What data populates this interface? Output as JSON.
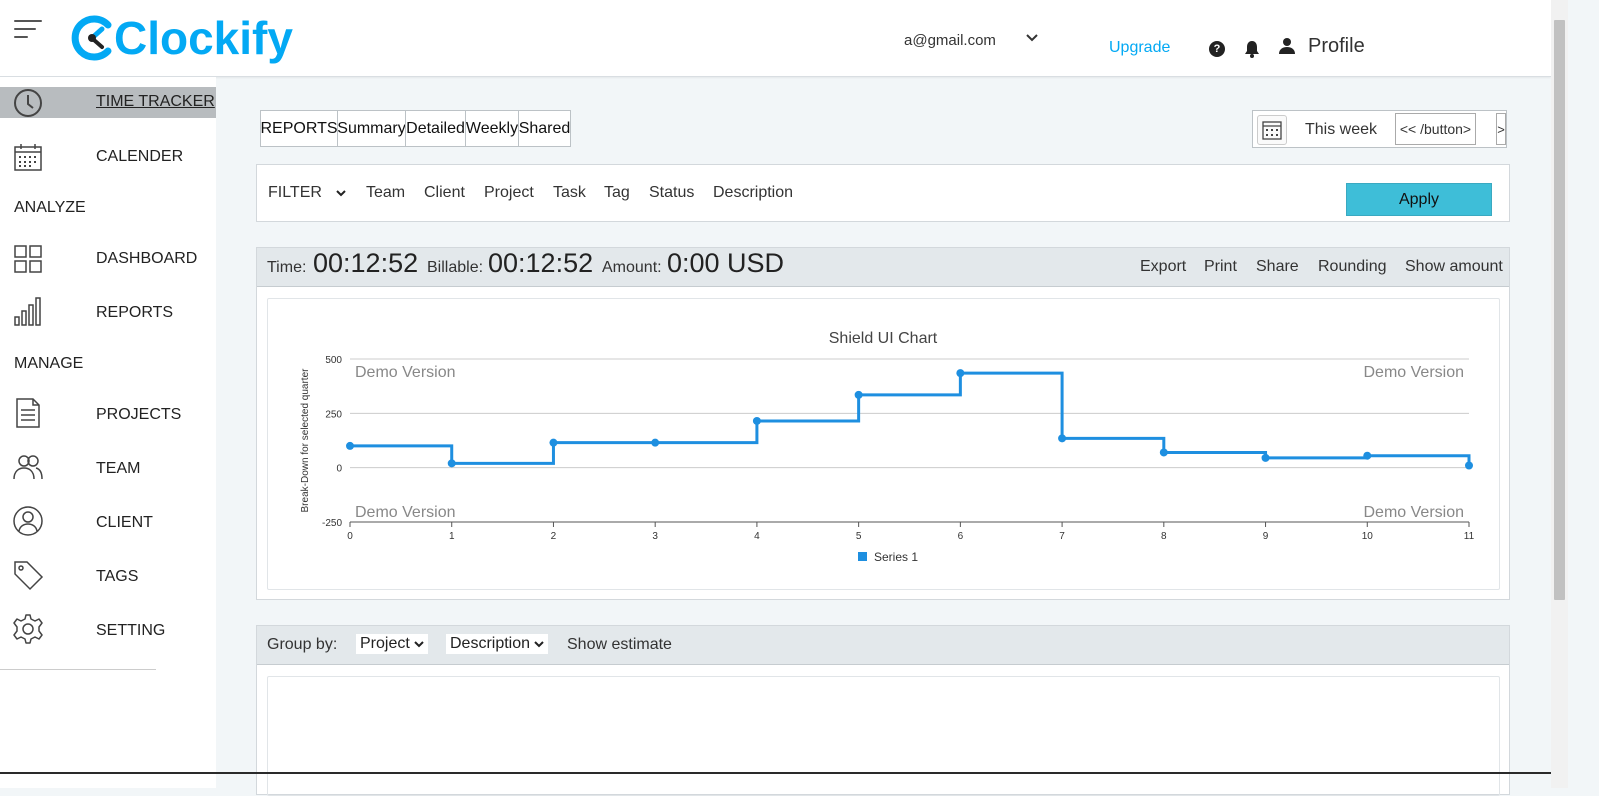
{
  "header": {
    "brand": "Clockify",
    "account_email": "a@gmail.com",
    "upgrade_label": "Upgrade",
    "help_glyph": "?",
    "profile_label": "Profile",
    "colors": {
      "brand": "#03a9f4",
      "upgrade": "#03a9f4"
    }
  },
  "sidebar": {
    "items": [
      {
        "label": "TIME TRACKER",
        "icon": "clock-icon",
        "active": true
      },
      {
        "label": "CALENDER",
        "icon": "calendar-icon"
      },
      {
        "label": "DASHBOARD",
        "icon": "dashboard-icon"
      },
      {
        "label": "REPORTS",
        "icon": "bar-chart-icon"
      },
      {
        "label": "PROJECTS",
        "icon": "document-icon"
      },
      {
        "label": "TEAM",
        "icon": "team-icon"
      },
      {
        "label": "CLIENT",
        "icon": "user-icon"
      },
      {
        "label": "TAGS",
        "icon": "tag-icon"
      },
      {
        "label": "SETTING",
        "icon": "gear-icon"
      }
    ],
    "sections": {
      "analyze": "ANALYZE",
      "manage": "MANAGE"
    },
    "colors": {
      "active_bg": "#b8bcbf"
    }
  },
  "tabs": [
    "REPORTS",
    "Summary",
    "Detailed",
    "Weekly",
    "Shared"
  ],
  "daterange": {
    "label": "This week",
    "prev_label": "<< /button>",
    "next_label": ">"
  },
  "filter": {
    "label": "FILTER",
    "items": [
      "Team",
      "Client",
      "Project",
      "Task",
      "Tag",
      "Status",
      "Description"
    ],
    "apply_label": "Apply",
    "colors": {
      "apply_bg": "#3ebed8"
    }
  },
  "summary": {
    "time_label": "Time:",
    "time_value": "00:12:52",
    "billable_label": "Billable:",
    "billable_value": "00:12:52",
    "amount_label": "Amount:",
    "amount_value": "0:00 USD",
    "actions": [
      "Export",
      "Print",
      "Share",
      "Rounding",
      "Show amount"
    ]
  },
  "chart_data": {
    "type": "line",
    "step": true,
    "title": "Shield UI Chart",
    "xlabel": "",
    "ylabel": "Break-Down for selected quarter",
    "x": [
      0,
      1,
      2,
      3,
      4,
      5,
      6,
      7,
      8,
      9,
      10,
      11
    ],
    "ylim": [
      -250,
      500
    ],
    "yticks": [
      -250,
      0,
      250,
      500
    ],
    "series": [
      {
        "name": "Series 1",
        "values": [
          100,
          20,
          115,
          115,
          215,
          335,
          435,
          135,
          70,
          45,
          55,
          10
        ],
        "color": "#1e8fe0"
      }
    ],
    "watermark": "Demo Version",
    "legend": "bottom-center",
    "grid": true
  },
  "groupby": {
    "label": "Group by:",
    "primary": "Project",
    "secondary": "Description",
    "show_estimate": "Show estimate"
  }
}
